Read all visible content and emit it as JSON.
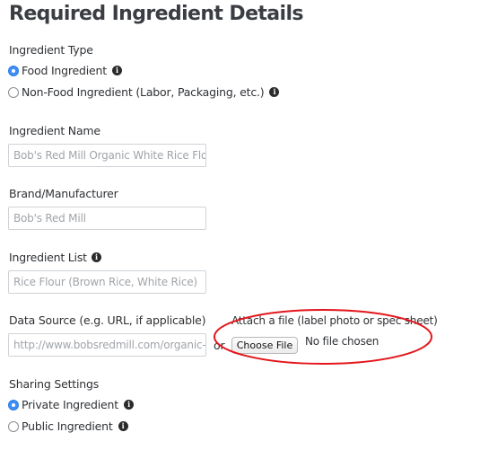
{
  "title": "Required Ingredient Details",
  "ingredient_type": {
    "label": "Ingredient Type",
    "options": [
      {
        "label": "Food Ingredient",
        "checked": true
      },
      {
        "label": "Non-Food Ingredient (Labor, Packaging, etc.)",
        "checked": false
      }
    ]
  },
  "ingredient_name": {
    "label": "Ingredient Name",
    "placeholder": "Bob's Red Mill Organic White Rice Flour"
  },
  "brand": {
    "label": "Brand/Manufacturer",
    "placeholder": "Bob's Red Mill"
  },
  "ingredient_list": {
    "label": "Ingredient List",
    "placeholder": "Rice Flour (Brown Rice, White Rice)"
  },
  "data_source": {
    "label": "Data Source (e.g. URL, if applicable)",
    "placeholder": "http://www.bobsredmill.com/organic-w"
  },
  "or_text": "or",
  "attach": {
    "label": "Attach a file (label photo or spec sheet)",
    "button": "Choose File",
    "status": "No file chosen"
  },
  "sharing": {
    "label": "Sharing Settings",
    "options": [
      {
        "label": "Private Ingredient",
        "checked": true
      },
      {
        "label": "Public Ingredient",
        "checked": false
      }
    ]
  },
  "annotation_color": "#e3161c",
  "radio_selected_color": "#3d8ef5"
}
